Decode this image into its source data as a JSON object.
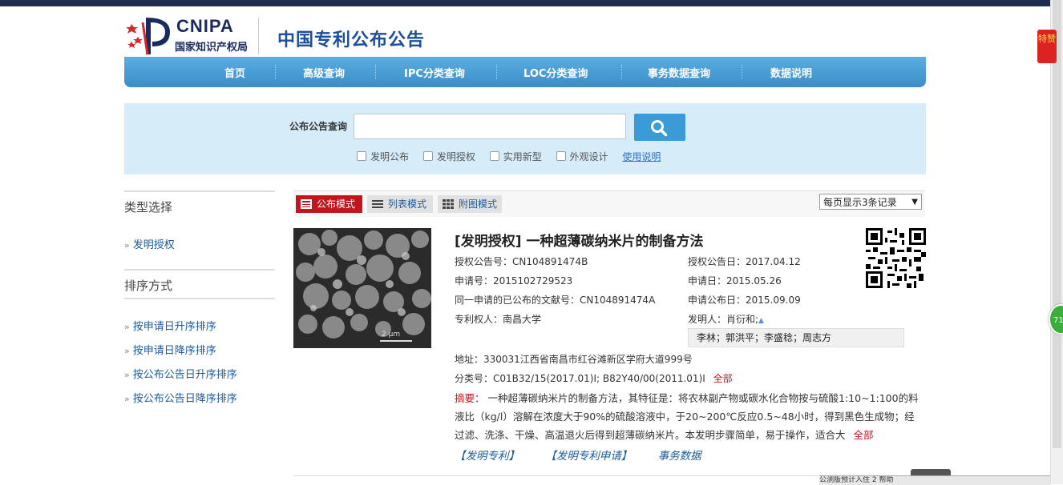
{
  "header": {
    "logo_en": "CNIPA",
    "logo_cn": "国家知识产权局",
    "site_title": "中国专利公布公告"
  },
  "nav": {
    "items": [
      "首页",
      "高级查询",
      "IPC分类查询",
      "LOC分类查询",
      "事务数据查询",
      "数据说明"
    ]
  },
  "search": {
    "label": "公布公告查询",
    "value": "",
    "filters": [
      "发明公布",
      "发明授权",
      "实用新型",
      "外观设计"
    ],
    "help": "使用说明"
  },
  "sidebar": {
    "type_heading": "类型选择",
    "type_items": [
      "发明授权"
    ],
    "sort_heading": "排序方式",
    "sort_items": [
      "按申请日升序排序",
      "按申请日降序排序",
      "按公布公告日升序排序",
      "按公布公告日降序排序"
    ]
  },
  "modes": {
    "items": [
      "公布模式",
      "列表模式",
      "附图模式"
    ],
    "active": "公布模式",
    "per_page": "每页显示3条记录"
  },
  "record": {
    "title": "[发明授权] 一种超薄碳纳米片的制备方法",
    "grant_no": "授权公告号：CN104891474B",
    "grant_date": "授权公告日：2017.04.12",
    "app_no": "申请号：2015102729523",
    "app_date": "申请日：2015.05.26",
    "same_app": "同一申请的已公布的文献号：CN104891474A",
    "pub_date": "申请公布日：2015.09.09",
    "patentee": "专利权人：南昌大学",
    "inventor": "发明人：肖衍和;",
    "inventors_more": "李林；郭洪平；李盛稔；周志方",
    "address": "地址：330031江西省南昌市红谷滩新区学府大道999号",
    "classification": "分类号：C01B32/15(2017.01)I;  B82Y40/00(2011.01)I",
    "all_label": "全部",
    "abstract_label": "摘要：",
    "abstract_text": "一种超薄碳纳米片的制备方法，其特征是：将农林副产物或碳水化合物按与硫酸1:10~1:100的料液比（kg/l）溶解在浓度大于90%的硫酸溶液中，于20~200℃反应0.5~48小时，得到黑色生成物；经过滤、洗涤、干燥、高温退火后得到超薄碳纳米片。本发明步骤简单，易于操作，适合大",
    "abstract_more": "全部",
    "scale_label": "2 μm",
    "actions": [
      "【发明专利】",
      "【发明专利申请】",
      "事务数据"
    ]
  },
  "overlays": {
    "fav": "特赞",
    "green": "71",
    "taskbar": "公测版预计入住 2   帮助"
  }
}
